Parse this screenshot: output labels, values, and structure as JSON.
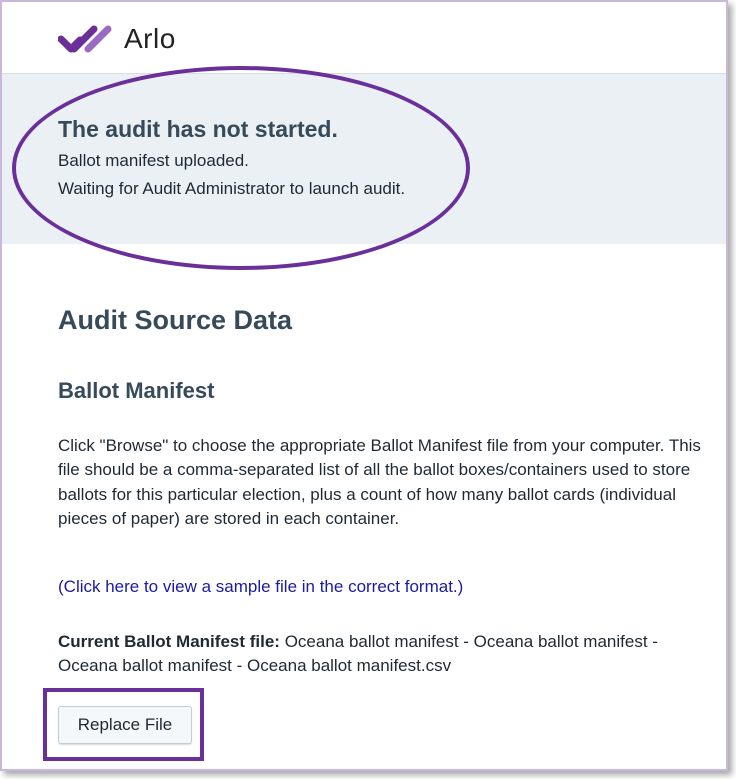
{
  "header": {
    "logo_text": "Arlo",
    "logo_icon": "arlo-checkmark-logo",
    "brand_color": "#6b2f9a"
  },
  "status": {
    "title": "The audit has not started.",
    "line1": "Ballot manifest uploaded.",
    "line2": "Waiting for Audit Administrator to launch audit."
  },
  "main": {
    "heading": "Audit Source Data",
    "subheading": "Ballot Manifest",
    "description": "Click \"Browse\" to choose the appropriate Ballot Manifest file from your computer. This file should be a comma-separated list of all the ballot boxes/containers used to store ballots for this particular election, plus a count of how many ballot cards (individual pieces of paper) are stored in each container.",
    "sample_link": "(Click here to view a sample file in the correct format.)",
    "current_file_label": "Current Ballot Manifest file:",
    "current_file_name": " Oceana ballot manifest - Oceana ballot manifest - Oceana ballot manifest - Oceana ballot manifest.csv",
    "replace_button": "Replace File"
  },
  "annotations": {
    "highlight_color": "#6b2f9a"
  }
}
